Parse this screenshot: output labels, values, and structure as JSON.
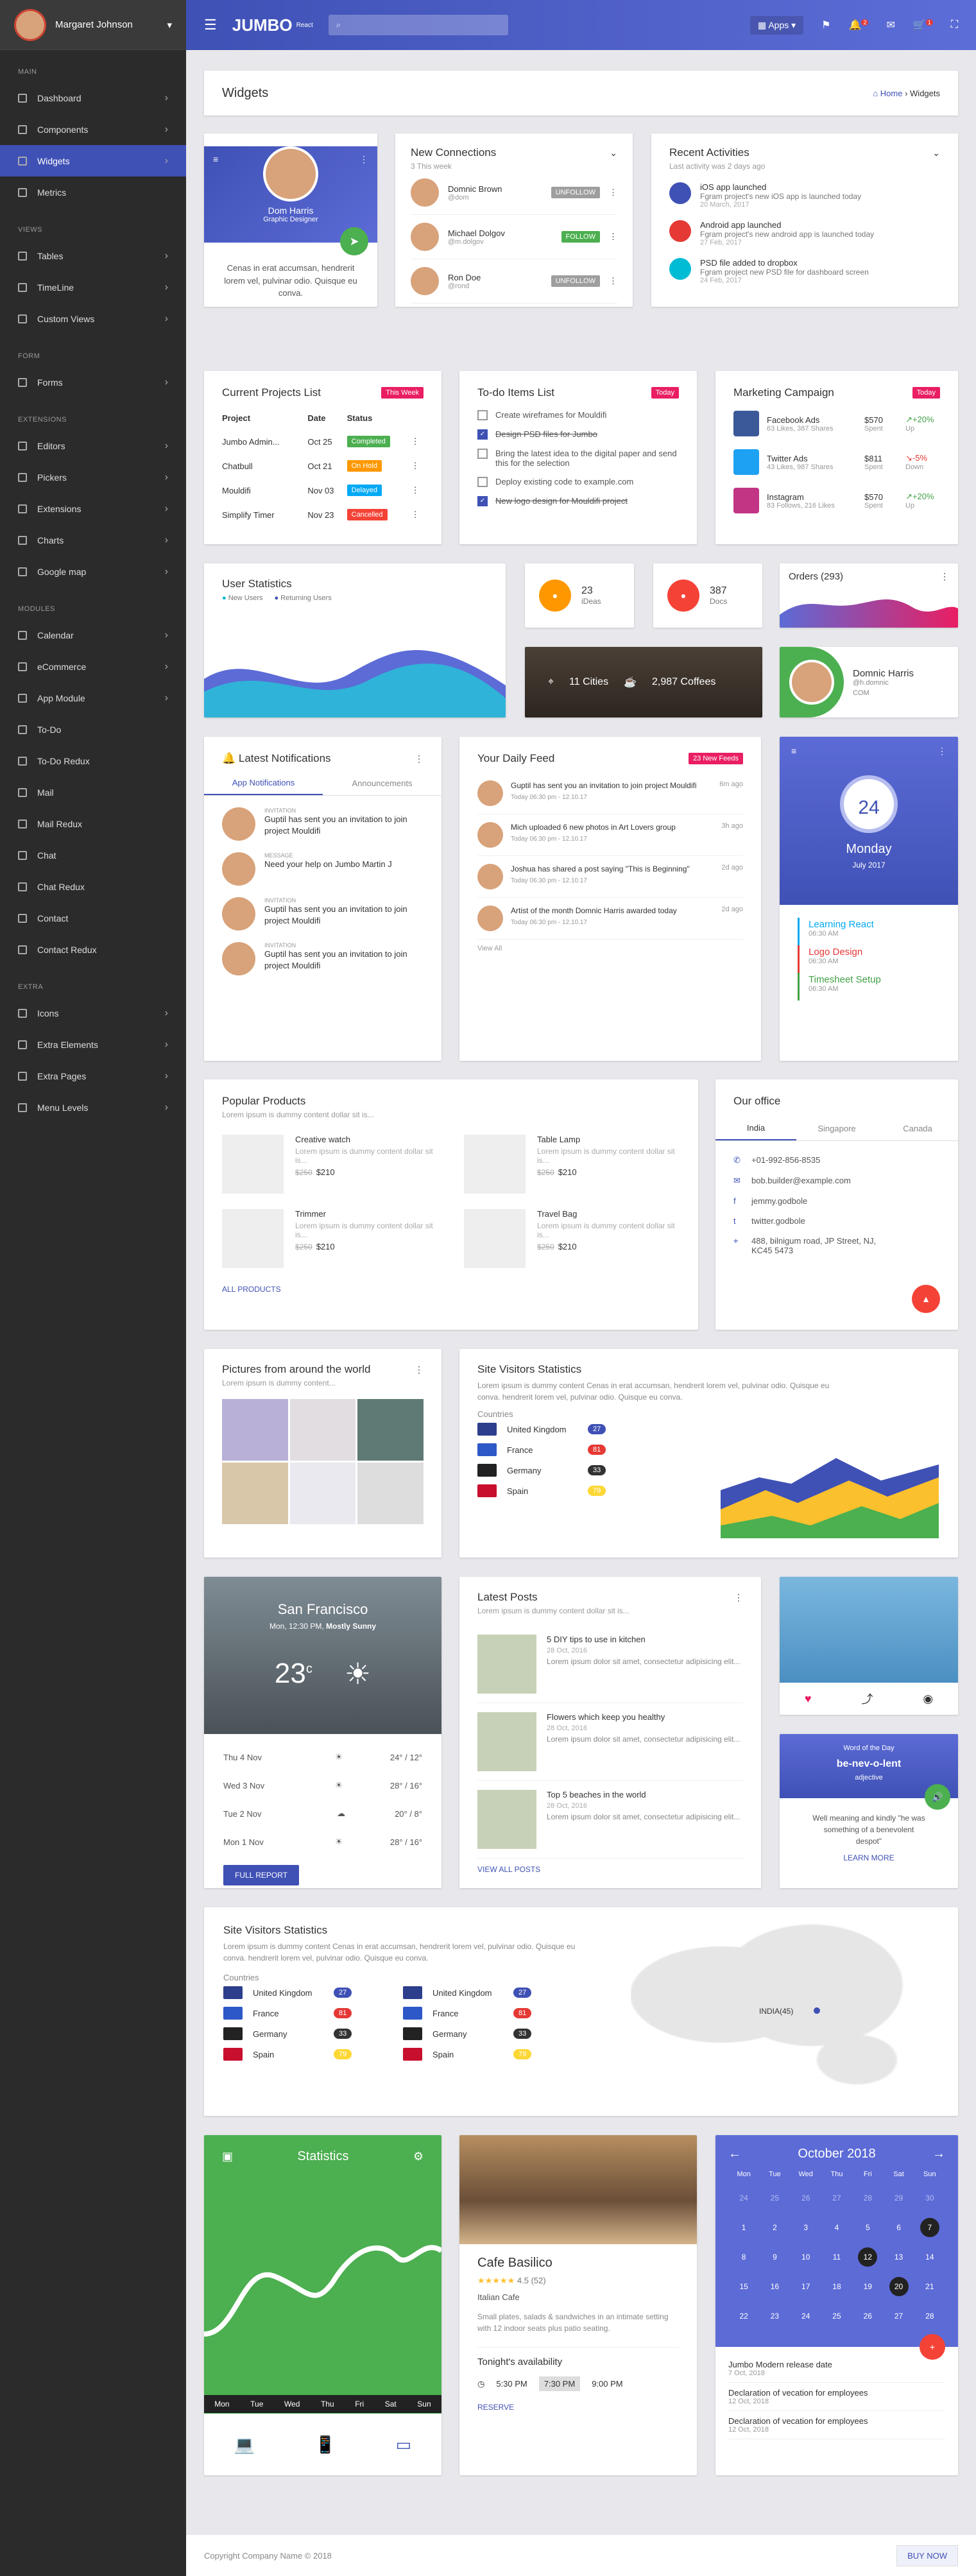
{
  "sidebar": {
    "user": "Margaret Johnson",
    "sections": [
      {
        "title": "MAIN",
        "items": [
          "Dashboard",
          "Components",
          "Widgets",
          "Metrics"
        ]
      },
      {
        "title": "VIEWS",
        "items": [
          "Tables",
          "TimeLine",
          "Custom Views"
        ]
      },
      {
        "title": "FORM",
        "items": [
          "Forms"
        ]
      },
      {
        "title": "EXTENSIONS",
        "items": [
          "Editors",
          "Pickers",
          "Extensions",
          "Charts",
          "Google map"
        ]
      },
      {
        "title": "MODULES",
        "items": [
          "Calendar",
          "eCommerce",
          "App Module",
          "To-Do",
          "To-Do Redux",
          "Mail",
          "Mail Redux",
          "Chat",
          "Chat Redux",
          "Contact",
          "Contact Redux"
        ]
      },
      {
        "title": "EXTRA",
        "items": [
          "Icons",
          "Extra Elements",
          "Extra Pages",
          "Menu Levels"
        ]
      }
    ]
  },
  "topbar": {
    "logo": "JUMBO",
    "logo_sub": "React",
    "apps": "Apps",
    "badges": [
      "2",
      "1"
    ]
  },
  "page": {
    "title": "Widgets",
    "crumb_home": "Home",
    "crumb_current": "Widgets"
  },
  "profile": {
    "name": "Dom Harris",
    "role": "Graphic Designer",
    "text": "Cenas in erat accumsan, hendrerit lorem vel, pulvinar odio. Quisque eu conva."
  },
  "connections": {
    "title": "New Connections",
    "sub": "3 This week",
    "people": [
      {
        "name": "Domnic Brown",
        "handle": "@dom",
        "action": "UNFOLLOW",
        "color": "#9e9e9e"
      },
      {
        "name": "Michael Dolgov",
        "handle": "@m.dolgov",
        "action": "FOLLOW",
        "color": "#4caf50"
      },
      {
        "name": "Ron Doe",
        "handle": "@rond",
        "action": "UNFOLLOW",
        "color": "#9e9e9e"
      }
    ]
  },
  "activities": {
    "title": "Recent Activities",
    "sub": "Last activity was 2 days ago",
    "items": [
      {
        "title": "iOS app launched",
        "text": "Fgram project's new iOS app is launched today",
        "date": "20 March, 2017",
        "color": "#3f51b5"
      },
      {
        "title": "Android app launched",
        "text": "Fgram project's new android app is launched today",
        "date": "27 Feb, 2017",
        "color": "#e53935"
      },
      {
        "title": "PSD file added to dropbox",
        "text": "Fgram project new PSD file for dashboard screen",
        "date": "24 Feb, 2017",
        "color": "#00bcd4"
      }
    ]
  },
  "projects": {
    "title": "Current Projects List",
    "badge": "This Week",
    "cols": [
      "Project",
      "Date",
      "Status"
    ],
    "rows": [
      {
        "name": "Jumbo Admin...",
        "date": "Oct 25",
        "status": "Completed",
        "color": "#4caf50"
      },
      {
        "name": "Chatbull",
        "date": "Oct 21",
        "status": "On Hold",
        "color": "#ff9800"
      },
      {
        "name": "Mouldifi",
        "date": "Nov 03",
        "status": "Delayed",
        "color": "#03a9f4"
      },
      {
        "name": "Simplify Timer",
        "date": "Nov 23",
        "status": "Cancelled",
        "color": "#f44336"
      }
    ]
  },
  "todo": {
    "title": "To-do Items List",
    "badge": "Today",
    "items": [
      {
        "text": "Create wireframes for Mouldifi",
        "done": false
      },
      {
        "text": "Design PSD files for Jumbo",
        "done": true
      },
      {
        "text": "Bring the latest idea to the digital paper and send this for the selection",
        "done": false
      },
      {
        "text": "Deploy existing code to example.com",
        "done": false
      },
      {
        "text": "New logo design for Mouldifi project",
        "done": true
      }
    ]
  },
  "campaign": {
    "title": "Marketing Campaign",
    "badge": "Today",
    "items": [
      {
        "name": "Facebook Ads",
        "meta": "63 Likes, 387 Shares",
        "amount": "$570",
        "label": "Spent",
        "delta": "↗+20%",
        "dlabel": "Up",
        "color": "#3b5998",
        "dcolor": "#43a047"
      },
      {
        "name": "Twitter Ads",
        "meta": "43 Likes, 987 Shares",
        "amount": "$811",
        "label": "Spent",
        "delta": "↘-5%",
        "dlabel": "Down",
        "color": "#1da1f2",
        "dcolor": "#e53935"
      },
      {
        "name": "Instagram",
        "meta": "83 Follows, 216 Likes",
        "amount": "$570",
        "label": "Spent",
        "delta": "↗+20%",
        "dlabel": "Up",
        "color": "#c13584",
        "dcolor": "#43a047"
      }
    ]
  },
  "userstats": {
    "title": "User Statistics",
    "legend": [
      "New Users",
      "Returning Users"
    ]
  },
  "ideas": {
    "count": "23",
    "label": "iDeas"
  },
  "docs": {
    "count": "387",
    "label": "Docs"
  },
  "orders": {
    "title": "Orders (293)"
  },
  "city": {
    "cities": "11 Cities",
    "coffees": "2,987 Coffees"
  },
  "domnic": {
    "name": "Domnic Harris",
    "handle": "@h.domnic",
    "role": "COM"
  },
  "notifications": {
    "title": "Latest Notifications",
    "tabs": [
      "App Notifications",
      "Announcements"
    ],
    "items": [
      {
        "type": "INVITATION",
        "text": "Guptil has sent you an invitation to join project Mouldifi"
      },
      {
        "type": "MESSAGE",
        "text": "Need your help on Jumbo Martin J"
      },
      {
        "type": "INVITATION",
        "text": "Guptil has sent you an invitation to join project Mouldifi"
      },
      {
        "type": "INVITATION",
        "text": "Guptil has sent you an invitation to join project Mouldifi"
      }
    ]
  },
  "feed": {
    "title": "Your Daily Feed",
    "badge": "23 New Feeds",
    "items": [
      {
        "text": "Guptil has sent you an invitation to join project Mouldifi",
        "time": "Today 06:30 pm - 12.10.17",
        "ago": "6m ago"
      },
      {
        "text": "Mich uploaded 6 new photos in Art Lovers group",
        "time": "Today 06:30 pm - 12.10.17",
        "ago": "3h ago"
      },
      {
        "text": "Joshua has shared a post saying \"This is Beginning\"",
        "time": "Today 06:30 pm - 12.10.17",
        "ago": "2d ago"
      },
      {
        "text": "Artist of the month Domnic Harris awarded today",
        "time": "Today 06:30 pm - 12.10.17",
        "ago": "2d ago"
      }
    ],
    "view_all": "View All"
  },
  "datecard": {
    "day": "24",
    "weekday": "Monday",
    "month": "July 2017",
    "events": [
      {
        "title": "Learning React",
        "time": "06:30 AM",
        "color": "#03a9f4"
      },
      {
        "title": "Logo Design",
        "time": "06:30 AM",
        "color": "#e53935"
      },
      {
        "title": "Timesheet Setup",
        "time": "06:30 AM",
        "color": "#43a047"
      }
    ]
  },
  "products": {
    "title": "Popular Products",
    "sub": "Lorem ipsum is dummy content dollar sit is...",
    "items": [
      {
        "name": "Creative watch",
        "desc": "Lorem ipsum is dummy content dollar sit is...",
        "old": "$250",
        "price": "$210"
      },
      {
        "name": "Table Lamp",
        "desc": "Lorem ipsum is dummy content dollar sit is...",
        "old": "$250",
        "price": "$210"
      },
      {
        "name": "Trimmer",
        "desc": "Lorem ipsum is dummy content dollar sit is...",
        "old": "$250",
        "price": "$210"
      },
      {
        "name": "Travel Bag",
        "desc": "Lorem ipsum is dummy content dollar sit is...",
        "old": "$250",
        "price": "$210"
      }
    ],
    "all": "ALL PRODUCTS"
  },
  "office": {
    "title": "Our office",
    "tabs": [
      "India",
      "Singapore",
      "Canada"
    ],
    "lines": [
      "+01-992-856-8535",
      "bob.builder@example.com",
      "jemmy.godbole",
      "twitter.godbole",
      "488, bilnigum road, JP Street, NJ, KC45 5473"
    ]
  },
  "pictures": {
    "title": "Pictures from around the world",
    "sub": "Lorem ipsum is dummy content..."
  },
  "visitors": {
    "title": "Site Visitors Statistics",
    "text": "Lorem ipsum is dummy content Cenas in erat accumsan, hendrerit lorem vel, pulvinar odio. Quisque eu conva. hendrerit lorem vel, pulvinar odio. Quisque eu conva.",
    "countries_label": "Countries",
    "countries": [
      {
        "name": "United Kingdom",
        "value": "27",
        "color": "#3f51b5"
      },
      {
        "name": "France",
        "value": "81",
        "color": "#e53935"
      },
      {
        "name": "Germany",
        "value": "33",
        "color": "#333"
      },
      {
        "name": "Spain",
        "value": "79",
        "color": "#fdd835"
      }
    ]
  },
  "weather": {
    "city": "San Francisco",
    "date": "Mon, 12:30 PM,",
    "cond": "Mostly Sunny",
    "temp": "23",
    "unit": "c",
    "days": [
      {
        "day": "Thu 4 Nov",
        "temp": "24° / 12°"
      },
      {
        "day": "Wed 3 Nov",
        "temp": "28° / 16°"
      },
      {
        "day": "Tue 2 Nov",
        "temp": "20° / 8°"
      },
      {
        "day": "Mon 1 Nov",
        "temp": "28° / 16°"
      }
    ],
    "btn": "FULL REPORT"
  },
  "posts": {
    "title": "Latest Posts",
    "sub": "Lorem ipsum is dummy content dollar sit is...",
    "items": [
      {
        "title": "5 DIY tips to use in kitchen",
        "date": "28 Oct, 2016",
        "text": "Lorem ipsum dolor sit amet, consectetur adipisicing elit..."
      },
      {
        "title": "Flowers which keep you healthy",
        "date": "28 Oct, 2016",
        "text": "Lorem ipsum dolor sit amet, consectetur adipisicing elit..."
      },
      {
        "title": "Top 5 beaches in the world",
        "date": "28 Oct, 2016",
        "text": "Lorem ipsum dolor sit amet, consectetur adipisicing elit..."
      }
    ],
    "all": "VIEW ALL POSTS"
  },
  "word": {
    "label": "Word of the Day",
    "word": "be-nev-o-lent",
    "type": "adjective",
    "text": "Well meaning and kindly \"he was something of a benevolent despot\"",
    "btn": "LEARN MORE"
  },
  "visitors2": {
    "title": "Site Visitors Statistics",
    "text": "Lorem ipsum is dummy content Cenas in erat accumsan, hendrerit lorem vel, pulvinar odio. Quisque eu conva. hendrerit lorem vel, pulvinar odio. Quisque eu conva.",
    "countries_label": "Countries",
    "marker": "INDIA(45)"
  },
  "stats": {
    "title": "Statistics",
    "days": [
      "Mon",
      "Tue",
      "Wed",
      "Thu",
      "Fri",
      "Sat",
      "Sun"
    ]
  },
  "cafe": {
    "name": "Cafe Basilico",
    "rating": "4.5 (52)",
    "type": "Italian Cafe",
    "text": "Small plates, salads & sandwiches in an intimate setting with 12 indoor seats plus patio seating.",
    "avail": "Tonight's availability",
    "times": [
      "5:30 PM",
      "7:30 PM",
      "9:00 PM"
    ],
    "btn": "RESERVE"
  },
  "calendar": {
    "title": "October 2018",
    "wd": [
      "Mon",
      "Tue",
      "Wed",
      "Thu",
      "Fri",
      "Sat",
      "Sun"
    ],
    "days": [
      "24",
      "25",
      "26",
      "27",
      "28",
      "29",
      "30",
      "1",
      "2",
      "3",
      "4",
      "5",
      "6",
      "7",
      "8",
      "9",
      "10",
      "11",
      "12",
      "13",
      "14",
      "15",
      "16",
      "17",
      "18",
      "19",
      "20",
      "21",
      "22",
      "23",
      "24",
      "25",
      "26",
      "27",
      "28"
    ],
    "events": [
      {
        "title": "Jumbo Modern release date",
        "date": "7 Oct, 2018"
      },
      {
        "title": "Declaration of vecation for employees",
        "date": "12 Oct, 2018"
      },
      {
        "title": "Declaration of vecation for employees",
        "date": "12 Oct, 2018"
      }
    ]
  },
  "footer": {
    "copy": "Copyright Company Name © 2018",
    "btn": "BUY NOW"
  }
}
